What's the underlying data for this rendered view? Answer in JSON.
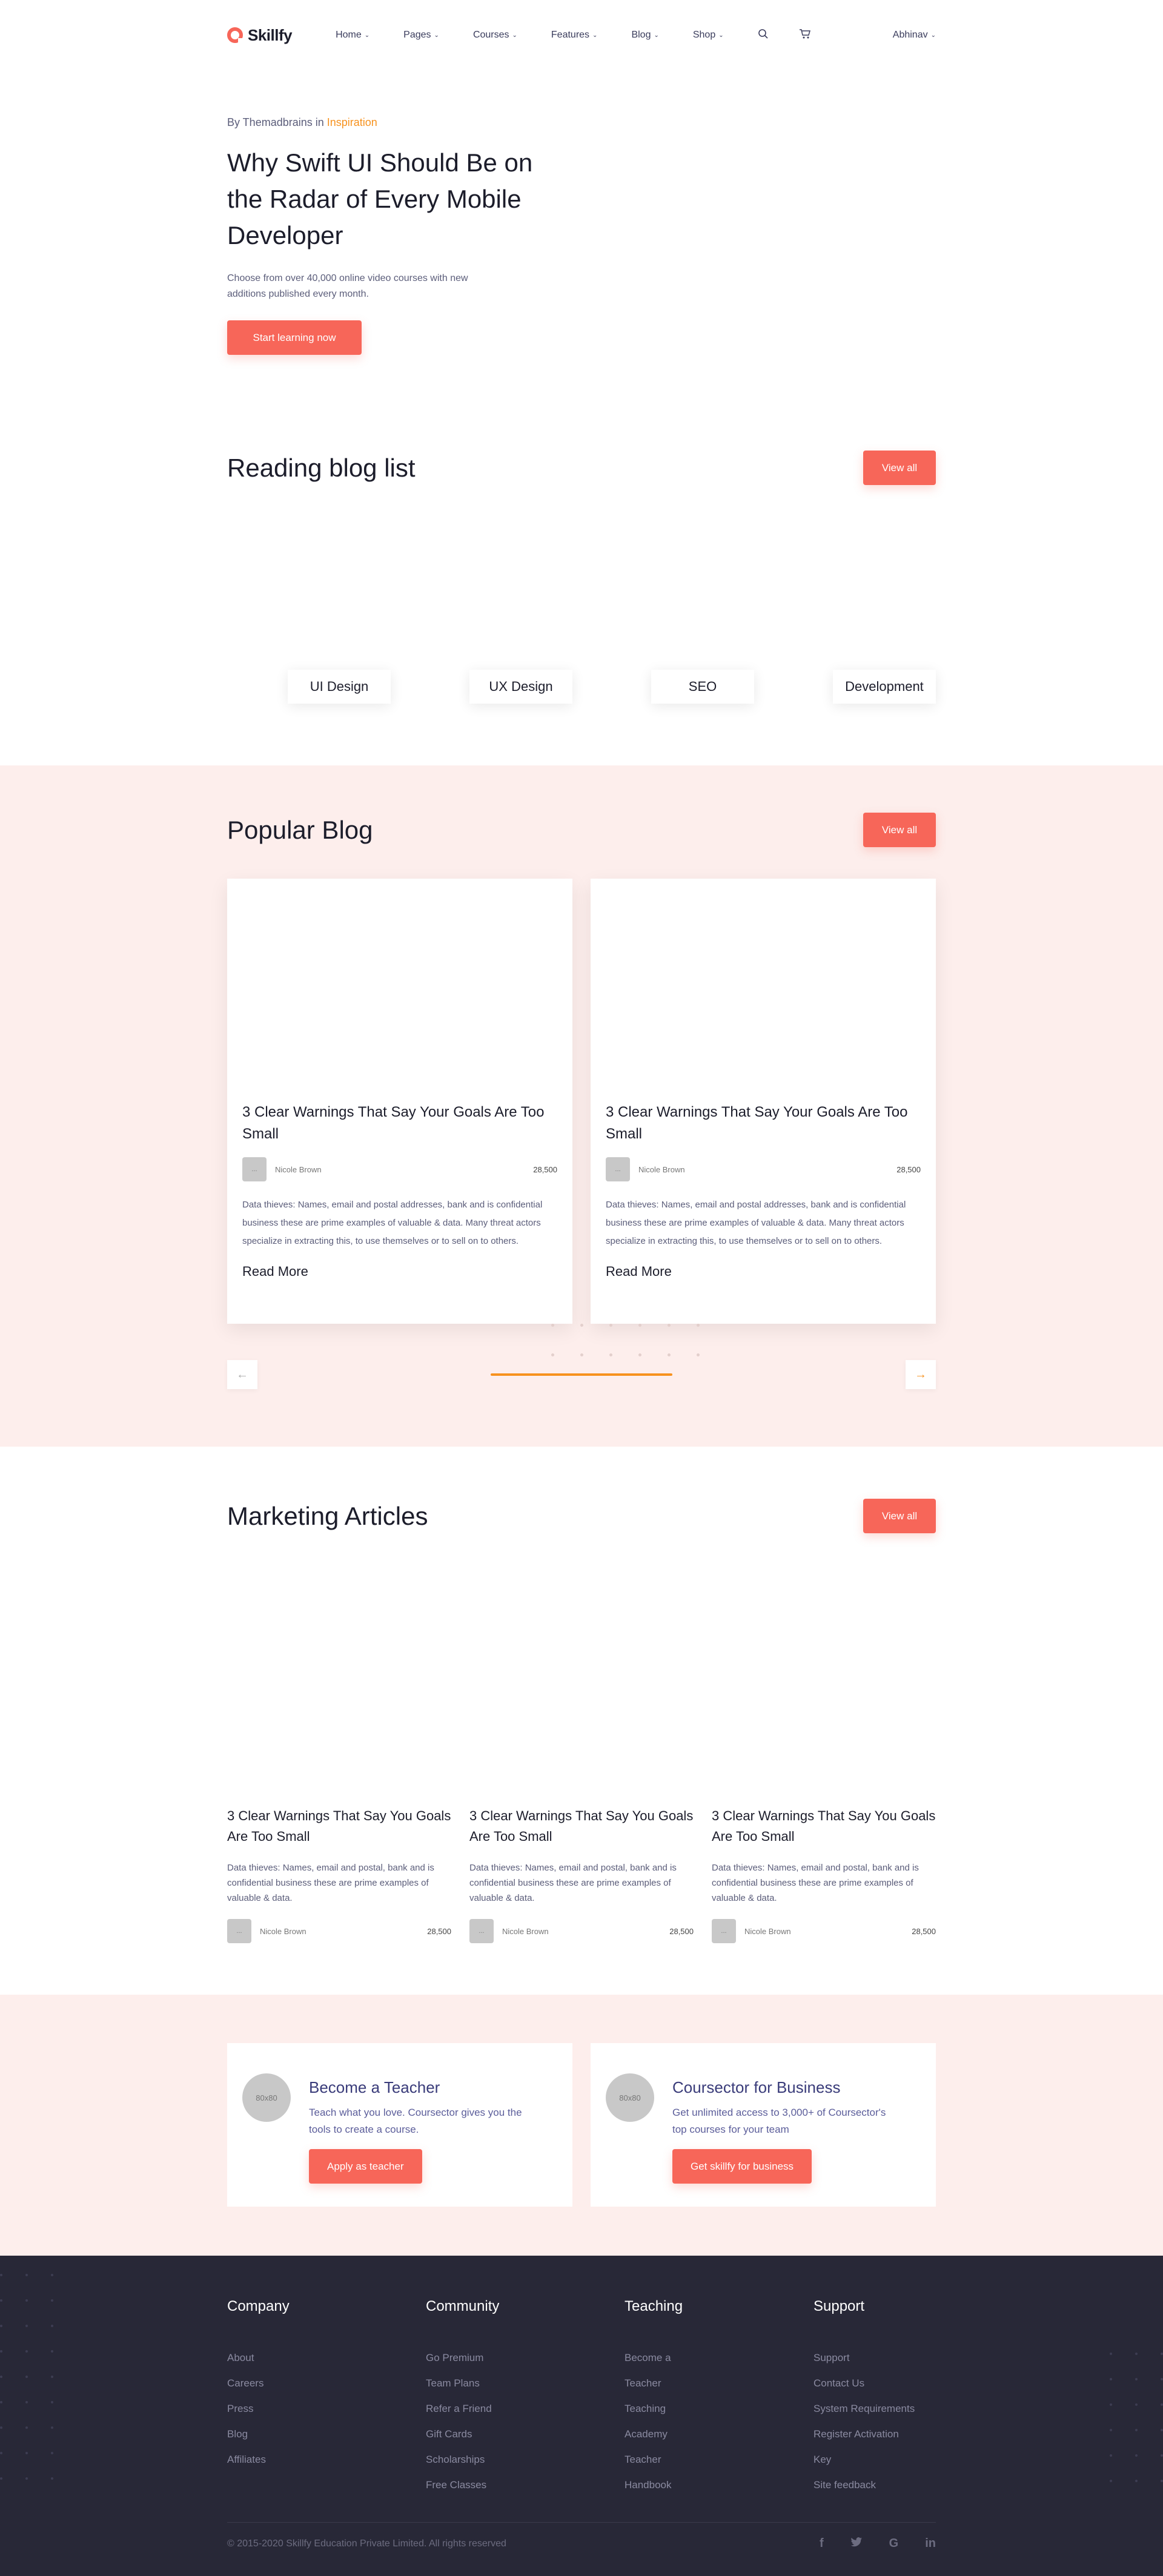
{
  "header": {
    "logo": "Skillfy",
    "nav": [
      "Home",
      "Pages",
      "Courses",
      "Features",
      "Blog",
      "Shop"
    ],
    "user": "Abhinav",
    "icons": [
      "search-icon",
      "cart-icon"
    ]
  },
  "hero": {
    "byline_prefix": "By Themadbrains in",
    "category": "Inspiration",
    "title": "Why Swift UI Should Be on the Radar of Every Mobile Developer",
    "subtitle": "Choose from over 40,000 online video courses with new additions published every month.",
    "cta": "Start learning now"
  },
  "reading": {
    "title": "Reading blog list",
    "view_all": "View all",
    "tags": [
      "UI Design",
      "UX Design",
      "SEO",
      "Development"
    ]
  },
  "popular": {
    "title": "Popular Blog",
    "view_all": "View all",
    "cards": [
      {
        "title": "3 Clear Warnings That Say Your Goals Are Too Small",
        "avatar": "...",
        "author": "Nicole Brown",
        "views": "28,500",
        "excerpt": "Data thieves: Names, email and postal addresses, bank and is confidential business these are prime examples of valuable & data. Many threat actors specialize in extracting this, to use themselves or to sell on to others.",
        "read_more": "Read More"
      },
      {
        "title": "3 Clear Warnings That Say Your Goals Are Too Small",
        "avatar": "...",
        "author": "Nicole Brown",
        "views": "28,500",
        "excerpt": "Data thieves: Names, email and postal addresses, bank and is confidential business these are prime examples of valuable & data. Many threat actors specialize in extracting this, to use themselves or to sell on to others.",
        "read_more": "Read More"
      }
    ]
  },
  "marketing": {
    "title": "Marketing Articles",
    "view_all": "View all",
    "cards": [
      {
        "title": "3 Clear Warnings That Say You Goals Are Too Small",
        "excerpt": "Data thieves: Names, email and postal, bank and is confidential business these are prime examples of valuable & data.",
        "avatar": "...",
        "author": "Nicole Brown",
        "views": "28,500"
      },
      {
        "title": "3 Clear Warnings That Say You Goals Are Too Small",
        "excerpt": "Data thieves: Names, email and postal, bank and is confidential business these are prime examples of valuable & data.",
        "avatar": "...",
        "author": "Nicole Brown",
        "views": "28,500"
      },
      {
        "title": "3 Clear Warnings That Say You Goals Are Too Small",
        "excerpt": "Data thieves: Names, email and postal, bank and is confidential business these are prime examples of valuable & data.",
        "avatar": "...",
        "author": "Nicole Brown",
        "views": "28,500"
      }
    ]
  },
  "cta": {
    "teacher": {
      "icon": "80x80",
      "title": "Become a Teacher",
      "text": "Teach what you love. Coursector gives you the tools to create a course.",
      "button": "Apply as teacher"
    },
    "business": {
      "icon": "80x80",
      "title": "Coursector for Business",
      "text": "Get unlimited access to 3,000+ of Coursector's top courses for your team",
      "button": "Get skillfy for business"
    }
  },
  "footer": {
    "columns": [
      {
        "title": "Company",
        "links": [
          "About",
          "Careers",
          "Press",
          "Blog",
          "Affiliates"
        ]
      },
      {
        "title": "Community",
        "links": [
          "Go Premium",
          "Team Plans",
          "Refer a Friend",
          "Gift Cards",
          "Scholarships",
          "Free Classes"
        ]
      },
      {
        "title": "Teaching",
        "links": [
          "Become a",
          "Teacher",
          "Teaching",
          "Academy",
          "Teacher",
          "Handbook"
        ]
      },
      {
        "title": "Support",
        "links": [
          "Support",
          "Contact Us",
          "System Requirements",
          "Register Activation",
          "Key",
          "Site feedback"
        ]
      }
    ],
    "copyright": "© 2015-2020 Skillfy Education Private Limited. All rights reserved",
    "social": [
      "facebook-icon",
      "twitter-icon",
      "google-icon",
      "linkedin-icon"
    ]
  },
  "colors": {
    "accent": "#f76659",
    "highlight": "#f7921e",
    "tint": "#fdeeec",
    "footer": "#282837"
  }
}
